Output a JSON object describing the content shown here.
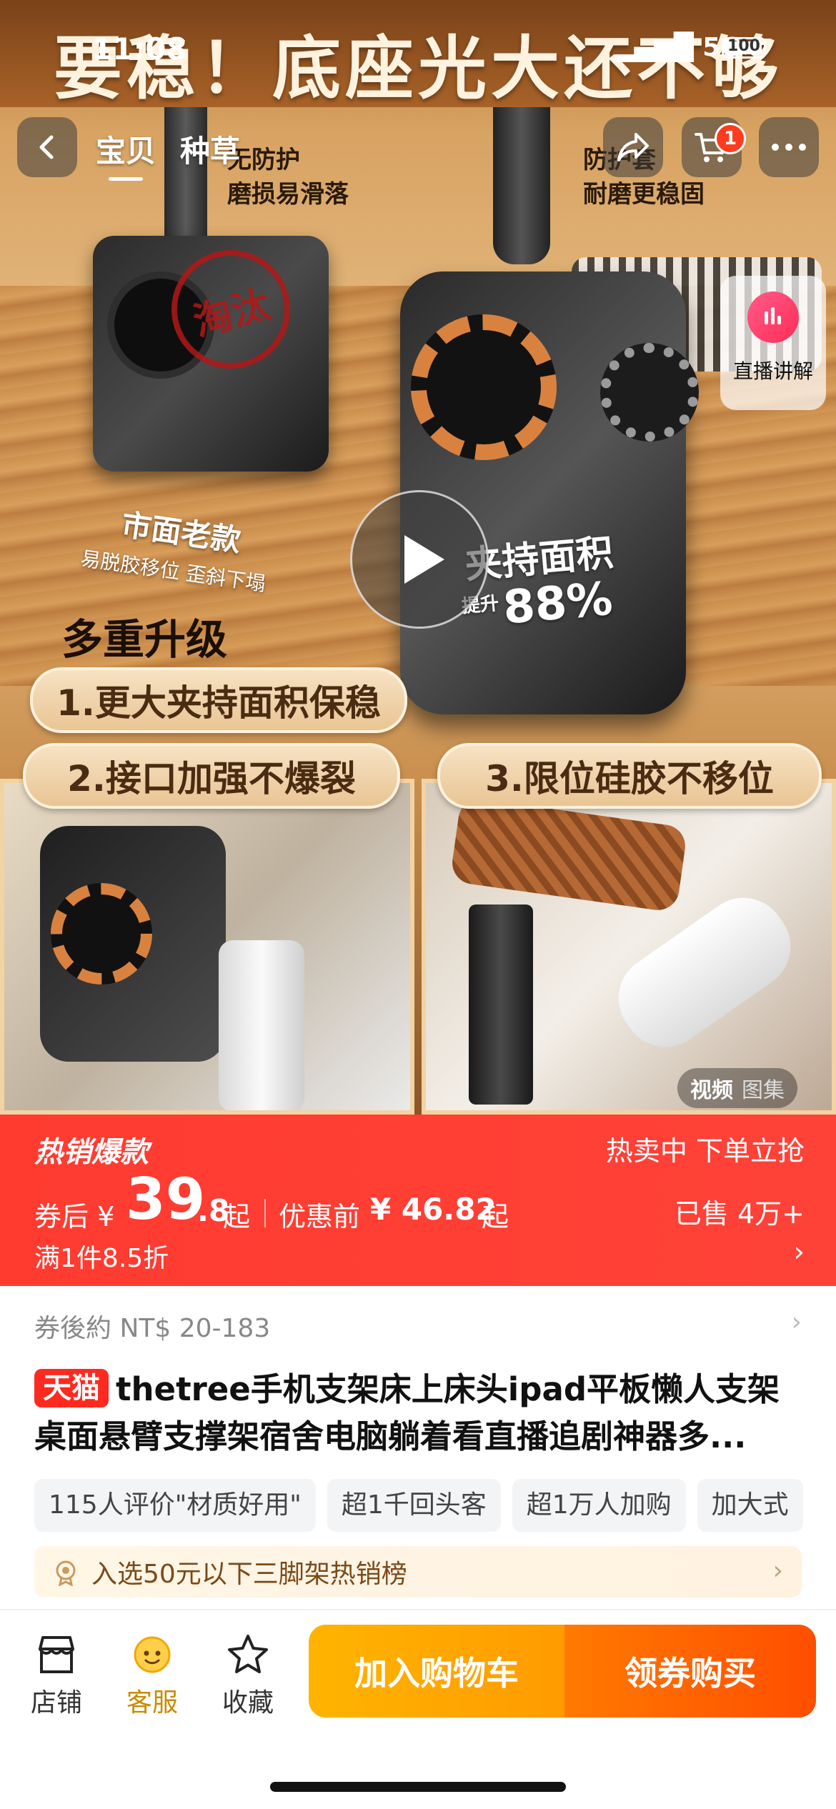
{
  "status_bar": {
    "time": "11:08",
    "network": "5G",
    "battery": "100"
  },
  "hero": {
    "headline": "要稳！底座光大还不够",
    "left_tag_title": "无防护",
    "left_tag_sub": "磨损易滑落",
    "right_tag_title": "防护套",
    "right_tag_sub": "耐磨更稳固",
    "stamp": "淘汰",
    "old_model_title": "市面老款",
    "old_model_sub": "易脱胶移位 歪斜下塌",
    "area_title": "夹持面积",
    "area_prefix": "提升",
    "area_value": "88%",
    "upgrade_title": "多重升级",
    "upgrade_1": "1.更大夹持面积保稳",
    "upgrade_2": "2.接口加强不爆裂",
    "upgrade_3": "3.限位硅胶不移位"
  },
  "nav": {
    "tabs": [
      "宝贝",
      "种草"
    ],
    "active_tab": "宝贝",
    "cart_count": "1",
    "live_label": "直播讲解"
  },
  "media_toggle": {
    "video": "视频",
    "gallery": "图集"
  },
  "price": {
    "tag": "热销爆款",
    "promo": "热卖中 下单立抢",
    "after_coupon_label": "券后",
    "currency": "¥",
    "price_int": "39",
    "price_dec": ".8",
    "price_suffix": "起",
    "original_label": "优惠前",
    "original_price": "¥ 46.82",
    "original_suffix": "起",
    "sold": "已售 4万+",
    "discount": "满1件8.5折"
  },
  "ntd_price": "券後約 NT$ 20-183",
  "product": {
    "badge": "天猫",
    "title_line1": "thetree手机支架床上床头ipad平板懒人支架",
    "title_line2": "桌面悬臂支撑架宿舍电脑躺着看直播追剧神器多..."
  },
  "chips": [
    "115人评价\"材质好用\"",
    "超1千回头客",
    "超1万人加购",
    "加大式"
  ],
  "ranking": "入选50元以下三脚架热销榜",
  "bottom": {
    "store": "店铺",
    "service": "客服",
    "favorite": "收藏",
    "add_cart": "加入购物车",
    "buy": "领券购买"
  },
  "colors": {
    "accent_red": "#ff3b30",
    "cart_btn": "#ffa800",
    "buy_btn": "#ff5a00"
  }
}
